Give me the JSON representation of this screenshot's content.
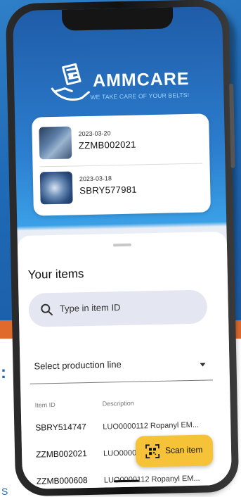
{
  "brand": {
    "name": "AMMCARE",
    "tagline": "WE TAKE CARE OF YOUR BELTS!",
    "colors": {
      "primary": "#1f6ab6",
      "accent": "#f6c238",
      "orange": "#e06a2c"
    }
  },
  "recent": [
    {
      "date": "2023-03-20",
      "id": "ZZMB002021",
      "thumb": "conveyor-photo"
    },
    {
      "date": "2023-03-18",
      "id": "SBRY577981",
      "thumb": "belt-roll-photo"
    }
  ],
  "items_section": {
    "title": "Your items",
    "search_placeholder": "Type in item ID",
    "select_value": "Select production line",
    "columns": {
      "item_id": "Item ID",
      "description": "Description"
    },
    "rows": [
      {
        "id": "SBRY514747",
        "desc": "LUO0000112 Ropanyl EM..."
      },
      {
        "id": "ZZMB002021",
        "desc": "LUO0000112 Ropanyl EM..."
      },
      {
        "id": "ZZMB000608",
        "desc": "LUO0000112 Ropanyl EM..."
      }
    ]
  },
  "fab": {
    "label": "Scan item",
    "icon": "qr-scan-icon"
  },
  "background_text": {
    "colon": ":",
    "s": "S"
  }
}
